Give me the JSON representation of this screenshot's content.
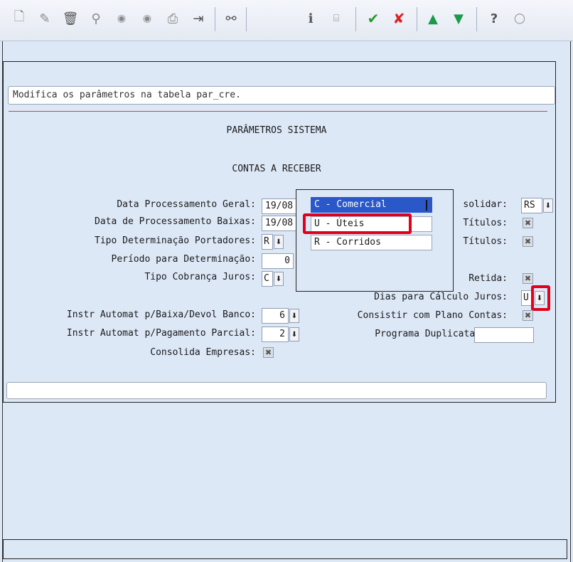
{
  "toolbar": {
    "buttons": [
      {
        "name": "new-icon",
        "glyph": "🗋"
      },
      {
        "name": "edit-icon",
        "glyph": "✎"
      },
      {
        "name": "delete-icon",
        "glyph": "🗑"
      },
      {
        "name": "search-icon",
        "glyph": "⚲"
      },
      {
        "name": "previous-icon",
        "glyph": "◉"
      },
      {
        "name": "next-icon",
        "glyph": "◉"
      },
      {
        "name": "print-icon",
        "glyph": "⎙"
      },
      {
        "name": "exit-icon",
        "glyph": "⇥"
      },
      {
        "name": "binoculars-icon",
        "glyph": "⚯"
      },
      {
        "name": "info-icon",
        "glyph": "ℹ"
      },
      {
        "name": "calculator-icon",
        "glyph": "⌸"
      },
      {
        "name": "confirm-icon",
        "glyph": "✔"
      },
      {
        "name": "cancel-icon",
        "glyph": "✘"
      },
      {
        "name": "up-icon",
        "glyph": "▲"
      },
      {
        "name": "down-icon",
        "glyph": "▼"
      },
      {
        "name": "help-icon",
        "glyph": "?"
      },
      {
        "name": "comment-icon",
        "glyph": "◯"
      }
    ]
  },
  "description": "Modifica os parâmetros na tabela par_cre.",
  "titles": {
    "system": "PARÂMETROS SISTEMA",
    "module": "CONTAS A RECEBER"
  },
  "labels": {
    "data_proc_geral": "Data Processamento Geral:",
    "data_proc_baixas": "Data de Processamento Baixas:",
    "tipo_det_portadores": "Tipo Determinação Portadores:",
    "periodo_determinacao": "Período para Determinação:",
    "tipo_cobranca_juros": "Tipo Cobrança Juros:",
    "instr_baixa": "Instr Automat p/Baixa/Devol Banco:",
    "instr_pagamento": "Instr Automat p/Pagamento Parcial:",
    "consolida_empresas": "Consolida Empresas:",
    "consolidar": "solidar:",
    "titulos_1": "Títulos:",
    "titulos_2": "Títulos:",
    "retida": "Retida:",
    "dias_calculo_juros": "Dias para Cálculo Juros:",
    "consistir_plano": "Consistir com Plano Contas:",
    "programa_duplicata": "Programa Duplicata:"
  },
  "values": {
    "data_proc_geral": "19/08",
    "data_proc_baixas": "19/08",
    "tipo_det_portadores": "R",
    "periodo_determinacao": "0",
    "tipo_cobranca_juros": "C",
    "instr_baixa": "6",
    "instr_pagamento": "2",
    "consolidar": "RS",
    "dias_calculo_juros": "U",
    "programa_duplicata": ""
  },
  "popup": {
    "options": [
      {
        "label": "C - Comercial",
        "selected": true
      },
      {
        "label": "U - Úteis",
        "selected": false
      },
      {
        "label": "R - Corridos",
        "selected": false
      }
    ]
  },
  "icons": {
    "dropdown": "⬇",
    "check": "✖"
  },
  "colors": {
    "highlight": "#e3001b",
    "selection": "#2a58c9",
    "background": "#dde8f7"
  }
}
